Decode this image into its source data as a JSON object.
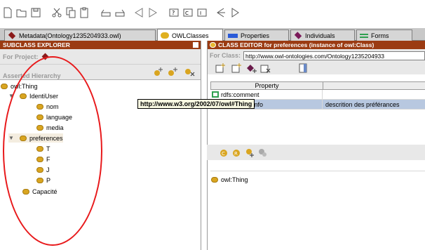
{
  "toolbar": {
    "icons": [
      "new-file-icon",
      "open-folder-icon",
      "save-icon",
      "cut-icon",
      "copy-icon",
      "paste-icon",
      "undo-icon",
      "redo-icon",
      "back-icon",
      "forward-icon",
      "ask-icon",
      "class-icon",
      "instance-icon",
      "prev-icon",
      "next-icon"
    ]
  },
  "tabs": [
    {
      "label": "Metadata(Ontology1235204933.owl)",
      "color": "#8b1a1a"
    },
    {
      "label": "OWLClasses",
      "color": "#e0b020"
    },
    {
      "label": "Properties",
      "color": "#2a5ad8"
    },
    {
      "label": "Individuals",
      "color": "#7a1a5a"
    },
    {
      "label": "Forms",
      "color": "#2fa050"
    }
  ],
  "left": {
    "header": "SUBCLASS EXPLORER",
    "for_project": "For Project:",
    "hierarchy_label": "Asserted Hierarchy",
    "tree": [
      {
        "label": "owl:Thing",
        "level": 0,
        "expander": ""
      },
      {
        "label": "IdentiUser",
        "level": 1,
        "expander": "▼"
      },
      {
        "label": "nom",
        "level": 2,
        "expander": ""
      },
      {
        "label": "language",
        "level": 2,
        "expander": ""
      },
      {
        "label": "media",
        "level": 2,
        "expander": ""
      },
      {
        "label": "preferences",
        "level": 1,
        "expander": "▼"
      },
      {
        "label": "T",
        "level": 2,
        "expander": ""
      },
      {
        "label": "F",
        "level": 2,
        "expander": ""
      },
      {
        "label": "J",
        "level": 2,
        "expander": ""
      },
      {
        "label": "P",
        "level": 2,
        "expander": ""
      },
      {
        "label": "Capacité",
        "level": 1,
        "expander": ""
      }
    ]
  },
  "right": {
    "header": "CLASS EDITOR for preferences   (instance of owl:Class)",
    "for_class_label": "For Class:",
    "for_class_value": "http://www.owl-ontologies.com/Ontology1235204933",
    "table_header": "Property",
    "rows": [
      {
        "property": "rdfs:comment",
        "value": ""
      },
      {
        "property": "owl:versionInfo",
        "value": "descrition des préférances"
      }
    ],
    "superclasses": [
      "owl:Thing"
    ]
  },
  "tooltip": "http://www.w3.org/2002/07/owl#Thing",
  "colors": {
    "header_bg": "#9b3b12",
    "class_bullet": "#d9a520",
    "highlight_ring": "#e8191b",
    "selected_row": "#b8c8e0"
  }
}
